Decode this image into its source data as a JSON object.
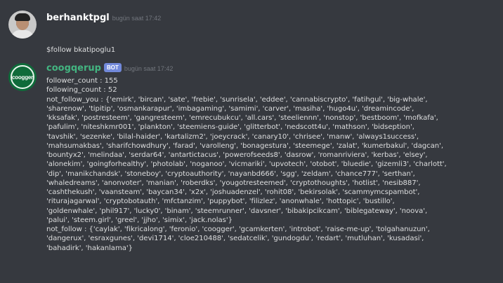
{
  "messages": [
    {
      "username": "berhanktpgl",
      "timestamp": "bugün saat 17:42",
      "is_bot": false,
      "avatar_icon": "user-photo-avatar",
      "lines": [
        "$follow bkatipoglu1"
      ]
    },
    {
      "username": "coogqerup",
      "bot_tag": "BOT",
      "timestamp": "bugün saat 17:42",
      "is_bot": true,
      "avatar_icon": "coogger-logo-avatar",
      "avatar_text": "coogger",
      "lines": [
        "follower_count : 155",
        "following_count : 52",
        "not_follow_you : {'emirk', 'bircan', 'sate', 'frebie', 'sunrisela', 'eddee', 'cannabiscrypto', 'fatihgul', 'big-whale',",
        "'sharenow', 'tipitip', 'osmankarapur', 'imbagaming', 'samimi', 'carver', 'masiha', 'hugo4u', 'dreamincode',",
        "'kksafak', 'postresteem', 'gangresteem', 'emrecubukcu', 'all.cars', 'steeliennn', 'nonstop', 'bestboom', 'mofkafa',",
        "'pafulim', 'niteshkmr001', 'plankton', 'steemiens-guide', 'glitterbot', 'nedscott4u', 'mathson', 'bidseption',",
        "'tavshik', 'sezenke', 'bilal-haider', 'kartalizm2', 'joeycrack', 'canary10', 'chrisee', 'manw', 'always1success',",
        "'mahsumakbas', 'sharifchowdhury', 'farad', 'varolleng', 'bonagestura', 'steemege', 'zalat', 'kumerbakul', 'dagcan',",
        "'bountyx2', 'melindaa', 'serdar64', 'antartictacus', 'powerofseeds8', 'dasrow', 'romanriviera', 'kerbas', 'elsey',",
        "'alonekim', 'goingforhealthy', 'photolab', 'noganoo', 'vicmariki', 'upvotech', 'otobot', 'bluedie', 'gizemli3', 'charlott',",
        "'dip', 'manikchandsk', 'stoneboy', 'cryptoauthority', 'nayanbd666', 'sgg', 'zeldam', 'chance777', 'serthan',",
        "'whaledreams', 'anonvoter', 'manian', 'roberdks', 'yougotresteemed', 'cryptothoughts', 'hotlist', 'nesib887',",
        "'cashthekush', 'vaansteam', 'baycan34', 'x2x', 'joshuadenzel', 'rohit08', 'bekirsolak', 'scammymcspambot',",
        "'rituraja­garwal', 'cryptobotauth', 'mfctanzim', 'puppybot', 'filizlez', 'anonwhale', 'hottopic', 'bustillo',",
        "'goldenwhale', 'phil917', 'lucky0', 'binam', 'steemrunner', 'davsner', 'bibakipcikcam', 'biblegateway', 'noova',",
        "'palui', 'steem.girl', 'greel', 'jjho', 'simix', 'jack.nolas'}",
        "not_follow : {'caylak', 'fikricalong', 'feronio', 'coogger', 'gcamkerten', 'introbot', 'raise-me-up', 'tolgahanuzun',",
        "'dangerux', 'esraxgunes', 'devi1714', 'cloe210488', 'sedatcelik', 'gundogdu', 'redart', 'mutluhan', 'kusadasi',",
        "'bahadirk', 'hakanlama'}"
      ]
    }
  ],
  "colors": {
    "background": "#36393f",
    "text": "#dcddde",
    "username_user": "#ffffff",
    "username_bot": "#43b581",
    "bot_tag": "#7289da",
    "timestamp": "#72767d"
  }
}
